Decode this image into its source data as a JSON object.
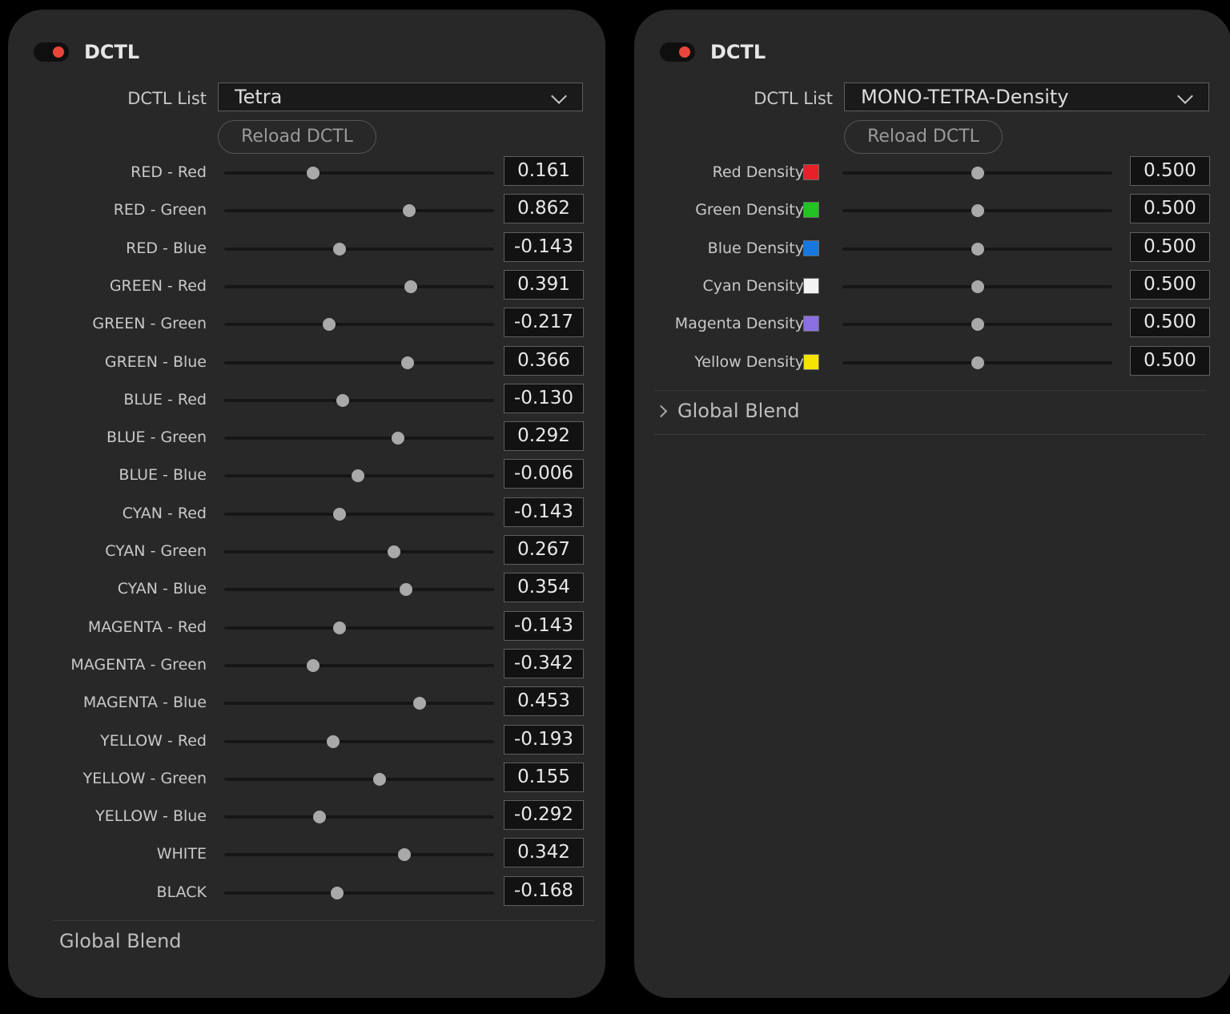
{
  "left_panel": {
    "title": "DCTL",
    "list_label": "DCTL List",
    "selected_dctl": "Tetra",
    "reload_label": "Reload DCTL",
    "global_blend_label": "Global Blend",
    "toggle_color": "#e8463a",
    "params": [
      {
        "label": "RED - Red",
        "value": "0.161",
        "slider_fraction": 0.33
      },
      {
        "label": "RED - Green",
        "value": "0.862",
        "slider_fraction": 0.685
      },
      {
        "label": "RED - Blue",
        "value": "-0.143",
        "slider_fraction": 0.426
      },
      {
        "label": "GREEN - Red",
        "value": "0.391",
        "slider_fraction": 0.69
      },
      {
        "label": "GREEN - Green",
        "value": "-0.217",
        "slider_fraction": 0.39
      },
      {
        "label": "GREEN - Blue",
        "value": "0.366",
        "slider_fraction": 0.679
      },
      {
        "label": "BLUE - Red",
        "value": "-0.130",
        "slider_fraction": 0.438
      },
      {
        "label": "BLUE - Green",
        "value": "0.292",
        "slider_fraction": 0.643
      },
      {
        "label": "BLUE - Blue",
        "value": "-0.006",
        "slider_fraction": 0.495
      },
      {
        "label": "CYAN - Red",
        "value": "-0.143",
        "slider_fraction": 0.426
      },
      {
        "label": "CYAN - Green",
        "value": "0.267",
        "slider_fraction": 0.628
      },
      {
        "label": "CYAN - Blue",
        "value": "0.354",
        "slider_fraction": 0.673
      },
      {
        "label": "MAGENTA - Red",
        "value": "-0.143",
        "slider_fraction": 0.426
      },
      {
        "label": "MAGENTA - Green",
        "value": "-0.342",
        "slider_fraction": 0.33
      },
      {
        "label": "MAGENTA - Blue",
        "value": "0.453",
        "slider_fraction": 0.723
      },
      {
        "label": "YELLOW - Red",
        "value": "-0.193",
        "slider_fraction": 0.405
      },
      {
        "label": "YELLOW - Green",
        "value": "0.155",
        "slider_fraction": 0.577
      },
      {
        "label": "YELLOW - Blue",
        "value": "-0.292",
        "slider_fraction": 0.354
      },
      {
        "label": "WHITE",
        "value": "0.342",
        "slider_fraction": 0.667
      },
      {
        "label": "BLACK",
        "value": "-0.168",
        "slider_fraction": 0.417
      }
    ]
  },
  "right_panel": {
    "title": "DCTL",
    "list_label": "DCTL List",
    "selected_dctl": "MONO-TETRA-Density",
    "reload_label": "Reload DCTL",
    "global_blend_label": "Global Blend",
    "toggle_color": "#e8463a",
    "params": [
      {
        "label": "Red Density",
        "value": "0.500",
        "slider_fraction": 0.5,
        "swatch_color": "#e8202a"
      },
      {
        "label": "Green Density",
        "value": "0.500",
        "slider_fraction": 0.5,
        "swatch_color": "#22c322"
      },
      {
        "label": "Blue Density",
        "value": "0.500",
        "slider_fraction": 0.5,
        "swatch_color": "#1677e0"
      },
      {
        "label": "Cyan Density",
        "value": "0.500",
        "slider_fraction": 0.5,
        "swatch_color": "#f2f2f2"
      },
      {
        "label": "Magenta Density",
        "value": "0.500",
        "slider_fraction": 0.5,
        "swatch_color": "#8a6fe0"
      },
      {
        "label": "Yellow Density",
        "value": "0.500",
        "slider_fraction": 0.5,
        "swatch_color": "#f5e400"
      }
    ]
  }
}
